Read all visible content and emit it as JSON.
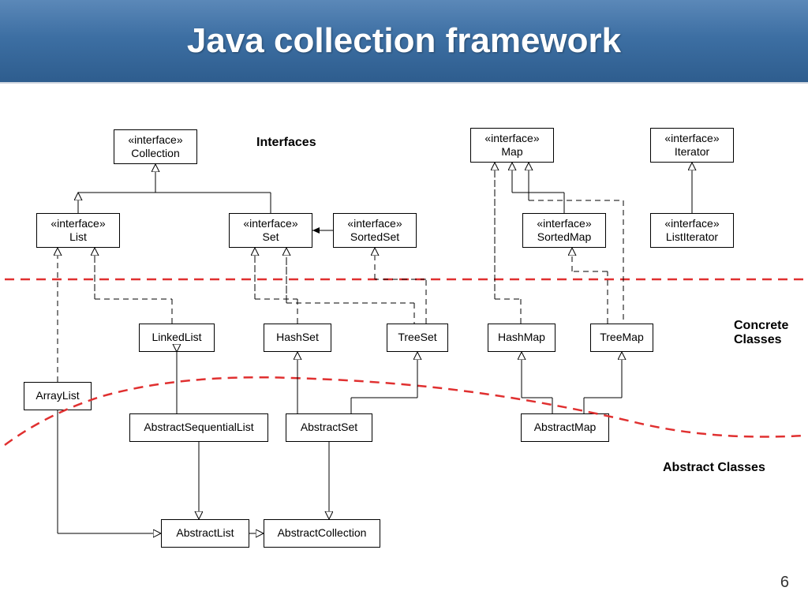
{
  "title": "Java collection framework",
  "labels": {
    "interfaces": "Interfaces",
    "concrete": "Concrete\nClasses",
    "abstract": "Abstract Classes"
  },
  "page_number": "6",
  "boxes": {
    "collection": {
      "stereo": "«interface»",
      "name": "Collection"
    },
    "map": {
      "stereo": "«interface»",
      "name": "Map"
    },
    "iterator": {
      "stereo": "«interface»",
      "name": "Iterator"
    },
    "list": {
      "stereo": "«interface»",
      "name": "List"
    },
    "set": {
      "stereo": "«interface»",
      "name": "Set"
    },
    "sortedset": {
      "stereo": "«interface»",
      "name": "SortedSet"
    },
    "sortedmap": {
      "stereo": "«interface»",
      "name": "SortedMap"
    },
    "listiterator": {
      "stereo": "«interface»",
      "name": "ListIterator"
    },
    "linkedlist": {
      "name": "LinkedList"
    },
    "hashset": {
      "name": "HashSet"
    },
    "treeset": {
      "name": "TreeSet"
    },
    "hashmap": {
      "name": "HashMap"
    },
    "treemap": {
      "name": "TreeMap"
    },
    "arraylist": {
      "name": "ArrayList"
    },
    "abstractsequentiallist": {
      "name": "AbstractSequentialList"
    },
    "abstractset": {
      "name": "AbstractSet"
    },
    "abstractmap": {
      "name": "AbstractMap"
    },
    "abstractlist": {
      "name": "AbstractList"
    },
    "abstractcollection": {
      "name": "AbstractCollection"
    }
  },
  "chart_data": {
    "type": "diagram",
    "title": "Java collection framework",
    "layers": [
      "Interfaces",
      "Concrete Classes",
      "Abstract Classes"
    ],
    "nodes": [
      {
        "id": "Collection",
        "kind": "interface",
        "layer": "Interfaces"
      },
      {
        "id": "Map",
        "kind": "interface",
        "layer": "Interfaces"
      },
      {
        "id": "Iterator",
        "kind": "interface",
        "layer": "Interfaces"
      },
      {
        "id": "List",
        "kind": "interface",
        "layer": "Interfaces"
      },
      {
        "id": "Set",
        "kind": "interface",
        "layer": "Interfaces"
      },
      {
        "id": "SortedSet",
        "kind": "interface",
        "layer": "Interfaces"
      },
      {
        "id": "SortedMap",
        "kind": "interface",
        "layer": "Interfaces"
      },
      {
        "id": "ListIterator",
        "kind": "interface",
        "layer": "Interfaces"
      },
      {
        "id": "LinkedList",
        "kind": "class",
        "layer": "Concrete Classes"
      },
      {
        "id": "HashSet",
        "kind": "class",
        "layer": "Concrete Classes"
      },
      {
        "id": "TreeSet",
        "kind": "class",
        "layer": "Concrete Classes"
      },
      {
        "id": "HashMap",
        "kind": "class",
        "layer": "Concrete Classes"
      },
      {
        "id": "TreeMap",
        "kind": "class",
        "layer": "Concrete Classes"
      },
      {
        "id": "ArrayList",
        "kind": "class",
        "layer": "Concrete Classes"
      },
      {
        "id": "AbstractSequentialList",
        "kind": "abstract",
        "layer": "Abstract Classes"
      },
      {
        "id": "AbstractSet",
        "kind": "abstract",
        "layer": "Abstract Classes"
      },
      {
        "id": "AbstractMap",
        "kind": "abstract",
        "layer": "Abstract Classes"
      },
      {
        "id": "AbstractList",
        "kind": "abstract",
        "layer": "Abstract Classes"
      },
      {
        "id": "AbstractCollection",
        "kind": "abstract",
        "layer": "Abstract Classes"
      }
    ],
    "edges": [
      {
        "from": "List",
        "to": "Collection",
        "type": "extends"
      },
      {
        "from": "Set",
        "to": "Collection",
        "type": "extends"
      },
      {
        "from": "SortedSet",
        "to": "Set",
        "type": "extends"
      },
      {
        "from": "SortedMap",
        "to": "Map",
        "type": "extends"
      },
      {
        "from": "ListIterator",
        "to": "Iterator",
        "type": "extends"
      },
      {
        "from": "ArrayList",
        "to": "List",
        "type": "implements"
      },
      {
        "from": "LinkedList",
        "to": "List",
        "type": "implements"
      },
      {
        "from": "HashSet",
        "to": "Set",
        "type": "implements"
      },
      {
        "from": "TreeSet",
        "to": "Set",
        "type": "implements"
      },
      {
        "from": "TreeSet",
        "to": "SortedSet",
        "type": "implements"
      },
      {
        "from": "HashMap",
        "to": "Map",
        "type": "implements"
      },
      {
        "from": "TreeMap",
        "to": "Map",
        "type": "implements"
      },
      {
        "from": "TreeMap",
        "to": "SortedMap",
        "type": "implements"
      },
      {
        "from": "ArrayList",
        "to": "AbstractList",
        "type": "extends"
      },
      {
        "from": "LinkedList",
        "to": "AbstractSequentialList",
        "type": "extends"
      },
      {
        "from": "HashSet",
        "to": "AbstractSet",
        "type": "extends"
      },
      {
        "from": "TreeSet",
        "to": "AbstractSet",
        "type": "extends"
      },
      {
        "from": "HashMap",
        "to": "AbstractMap",
        "type": "extends"
      },
      {
        "from": "TreeMap",
        "to": "AbstractMap",
        "type": "extends"
      },
      {
        "from": "AbstractSequentialList",
        "to": "AbstractList",
        "type": "extends"
      },
      {
        "from": "AbstractList",
        "to": "AbstractCollection",
        "type": "extends"
      },
      {
        "from": "AbstractSet",
        "to": "AbstractCollection",
        "type": "extends"
      }
    ]
  }
}
